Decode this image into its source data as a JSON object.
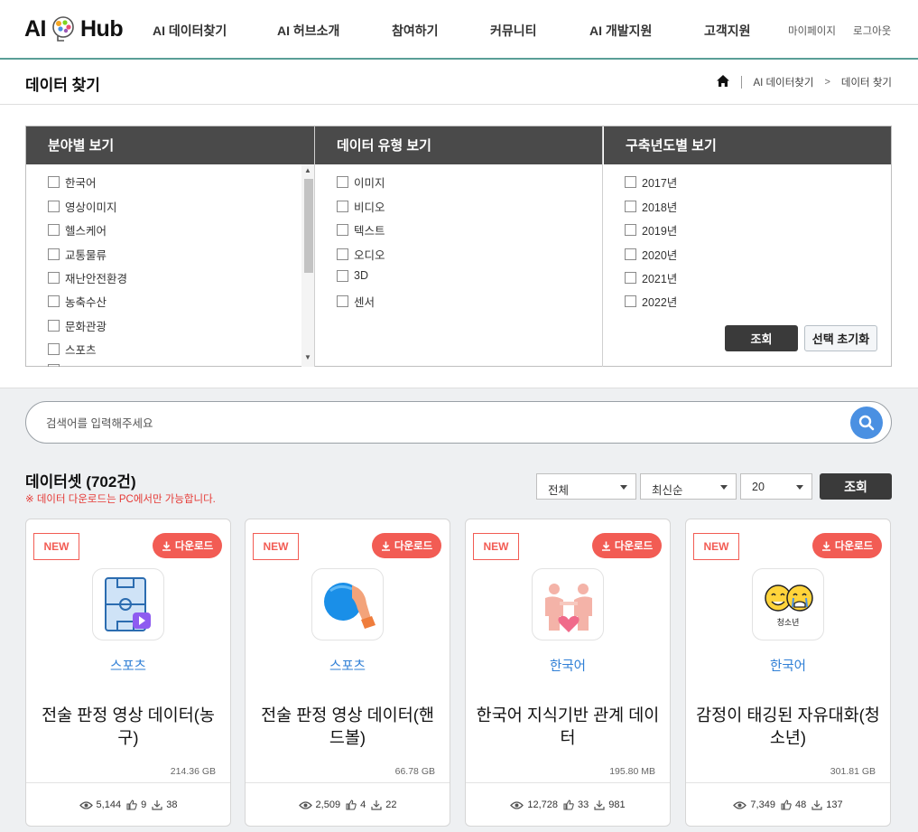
{
  "header": {
    "logo": {
      "left": "AI",
      "right": "Hub"
    },
    "nav": [
      "AI 데이터찾기",
      "AI 허브소개",
      "참여하기",
      "커뮤니티",
      "AI 개발지원",
      "고객지원"
    ],
    "util": [
      "마이페이지",
      "로그아웃"
    ]
  },
  "subheader": {
    "title": "데이터 찾기",
    "breadcrumb": [
      "AI 데이터찾기",
      "데이터 찾기"
    ]
  },
  "filters": {
    "field": {
      "title": "분야별 보기",
      "items": [
        "한국어",
        "영상이미지",
        "헬스케어",
        "교통물류",
        "재난안전환경",
        "농축수산",
        "문화관광",
        "스포츠"
      ]
    },
    "type": {
      "title": "데이터 유형 보기",
      "items": [
        "이미지",
        "비디오",
        "텍스트",
        "오디오",
        "3D",
        "센서"
      ]
    },
    "year": {
      "title": "구축년도별 보기",
      "items": [
        "2017년",
        "2018년",
        "2019년",
        "2020년",
        "2021년",
        "2022년"
      ]
    },
    "search_button": "조회",
    "reset_button": "선택 초기화"
  },
  "search": {
    "placeholder": "검색어를 입력해주세요"
  },
  "results": {
    "title": "데이터셋 (702건)",
    "note": "※ 데이터 다운로드는 PC에서만 가능합니다.",
    "filter_select": "전체",
    "sort_select": "최신순",
    "count_select": "20",
    "query_button": "조회"
  },
  "cards": [
    {
      "badge": "NEW",
      "download": "다운로드",
      "category": "스포츠",
      "title": "전술 판정 영상 데이터(농구)",
      "size": "214.36 GB",
      "views": "5,144",
      "likes": "9",
      "downloads": "38",
      "icon": "basketball-court-icon"
    },
    {
      "badge": "NEW",
      "download": "다운로드",
      "category": "스포츠",
      "title": "전술 판정 영상 데이터(핸드볼)",
      "size": "66.78 GB",
      "views": "2,509",
      "likes": "4",
      "downloads": "22",
      "icon": "handball-icon"
    },
    {
      "badge": "NEW",
      "download": "다운로드",
      "category": "한국어",
      "title": "한국어 지식기반 관계 데이터",
      "size": "195.80 MB",
      "views": "12,728",
      "likes": "33",
      "downloads": "981",
      "icon": "people-heart-icon"
    },
    {
      "badge": "NEW",
      "download": "다운로드",
      "category": "한국어",
      "title": "감정이 태깅된 자유대화(청소년)",
      "size": "301.81 GB",
      "views": "7,349",
      "likes": "48",
      "downloads": "137",
      "icon": "emotion-faces-icon",
      "icon_caption": "청소년"
    }
  ],
  "colors": {
    "accent_red": "#f25c54",
    "link_blue": "#2f7fd6",
    "search_blue": "#4a90e2",
    "header_dark": "#4a4a4a"
  }
}
